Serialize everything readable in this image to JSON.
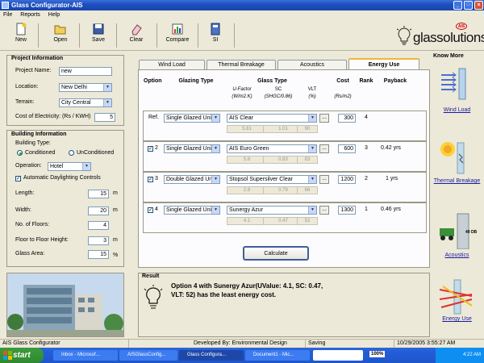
{
  "window": {
    "title": "Glass Configurator-AIS"
  },
  "menu": [
    "File",
    "Reports",
    "Help"
  ],
  "toolbar": {
    "new": "New",
    "open": "Open",
    "save": "Save",
    "clear": "Clear",
    "compare": "Compare",
    "si": "SI"
  },
  "brand": {
    "logo": "glassolutions",
    "badge": "AIS"
  },
  "project": {
    "title": "Project Information",
    "name_label": "Project Name:",
    "name_value": "new",
    "location_label": "Location:",
    "location_value": "New Delhi",
    "terrain_label": "Terrain:",
    "terrain_value": "City Central",
    "cost_label": "Cost of Electricity: (Rs / KWH)",
    "cost_value": "5"
  },
  "building": {
    "title": "Building Information",
    "type_label": "Building Type:",
    "conditioned": "Conditioned",
    "unconditioned": "UnConditioned",
    "operation_label": "Operation:",
    "operation_value": "Hotel",
    "daylight_label": "Automatic Daylighting Controls",
    "length_label": "Length:",
    "length_value": "15",
    "length_unit": "m",
    "width_label": "Width:",
    "width_value": "20",
    "width_unit": "m",
    "floors_label": "No. of Floors:",
    "floors_value": "4",
    "height_label": "Floor to Floor Height:",
    "height_value": "3",
    "height_unit": "m",
    "area_label": "Glass Area:",
    "area_value": "15",
    "area_unit": "%"
  },
  "tabs": [
    "Wind Load",
    "Thermal Breakage",
    "Acoustics",
    "Energy Use"
  ],
  "table": {
    "headers": {
      "option": "Option",
      "glazing": "Glazing Type",
      "glass": "Glass Type",
      "cost": "Cost",
      "rank": "Rank",
      "payback": "Payback",
      "ufactor": "U-Factor",
      "sc": "SC",
      "vlt": "VLT",
      "ufactor_unit": "(W/m2.K)",
      "sc_unit": "(SHGC/0.86)",
      "vlt_unit": "(%)",
      "cost_unit": "(Rs/m2)"
    },
    "rows": [
      {
        "option": "Ref.",
        "glazing": "Single Glazed Unit",
        "glass": "AIS Clear",
        "u": "5.81",
        "sc": "1.01",
        "vlt": "90",
        "cost": "300",
        "rank": "4",
        "payback": ""
      },
      {
        "option": "2",
        "glazing": "Single Glazed Unit",
        "glass": "AIS Euro Green",
        "u": "5.8",
        "sc": "0.83",
        "vlt": "83",
        "cost": "600",
        "rank": "3",
        "payback": "0.42 yrs"
      },
      {
        "option": "3",
        "glazing": "Double Glazed Unit",
        "glass": "Stopsol Supersilver Clear",
        "u": "2.8",
        "sc": "0.79",
        "vlt": "66",
        "cost": "1200",
        "rank": "2",
        "payback": "1 yrs"
      },
      {
        "option": "4",
        "glazing": "Single Glazed Unit",
        "glass": "Sunergy Azur",
        "u": "4.1",
        "sc": "0.47",
        "vlt": "52",
        "cost": "1300",
        "rank": "1",
        "payback": "0.46 yrs"
      }
    ],
    "browse": "...",
    "calculate": "Calculate"
  },
  "result": {
    "title": "Result",
    "text": "Option 4 with Sunergy Azur(UValue: 4.1, SC: 0.47, VLT: 52) has the least energy cost."
  },
  "know_more": {
    "title": "Know More",
    "links": [
      "Wind Load",
      "Thermal Breakage",
      "Acoustics",
      "Energy Use"
    ],
    "acoustic_badge": "40 DB"
  },
  "status": {
    "app": "AIS Glass Configurator",
    "dev": "Developed By: Environmental Design Solutions",
    "state": "Saving",
    "datetime": "10/29/2005 3:55:27 AM"
  },
  "taskbar": {
    "start": "start",
    "tasks": [
      "Inbox - Microsof...",
      "AISGlassConfig...",
      "Glass Configura...",
      "Document1 - Mic..."
    ],
    "zoom": "100%",
    "clock": "4:22 AM"
  }
}
